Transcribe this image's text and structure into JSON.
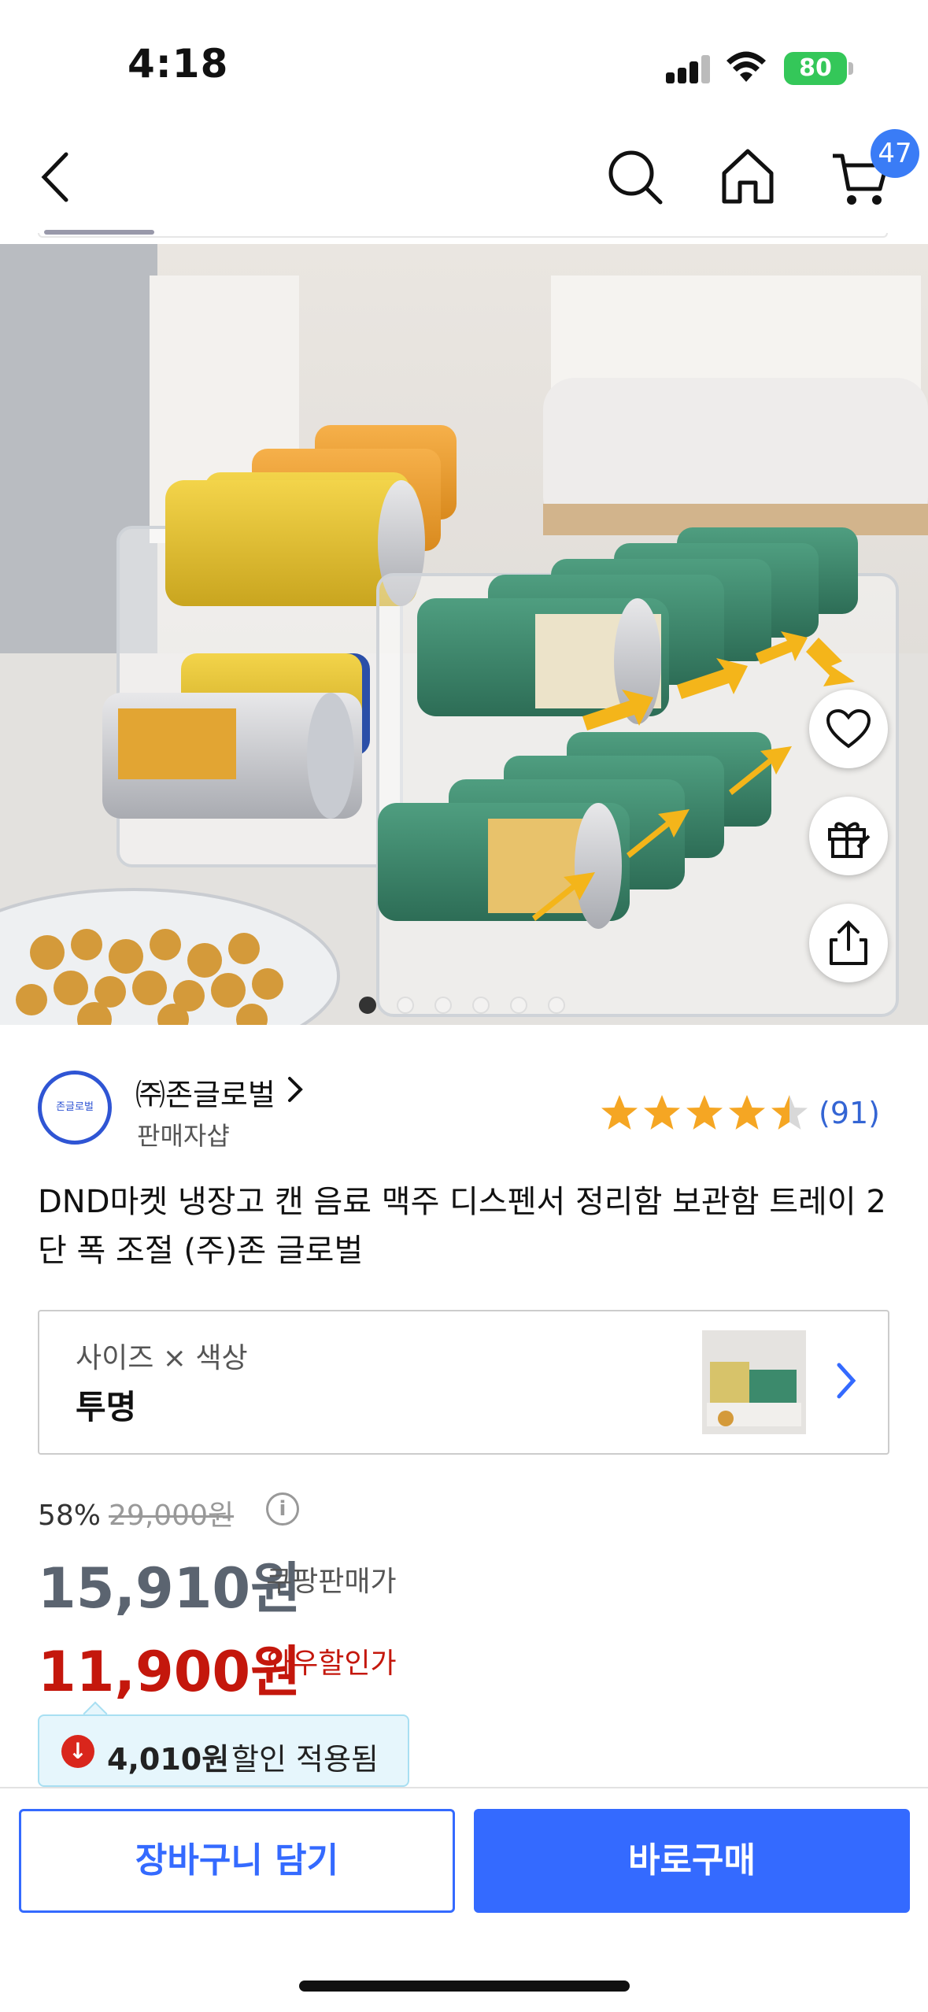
{
  "status_bar": {
    "time": "4:18",
    "battery": "80"
  },
  "header": {
    "back_icon": "chevron-left-icon",
    "search_icon": "search-icon",
    "home_icon": "home-icon",
    "cart_icon": "cart-icon",
    "cart_count": "47"
  },
  "gallery": {
    "image_count": 6,
    "active_index": 0,
    "actions": [
      "heart-icon",
      "gift-icon",
      "share-icon"
    ]
  },
  "seller": {
    "logo_text": "존글로벌",
    "name": "㈜존글로벌",
    "subtitle": "판매자샵",
    "rating": 4.5,
    "review_count": "(91)"
  },
  "product": {
    "title": "DND마켓 냉장고 캔 음료 맥주 디스펜서 정리함 보관함 트레이 2단 폭 조절 (주)존 글로벌"
  },
  "option": {
    "label": "사이즈 × 색상",
    "value": "투명"
  },
  "price": {
    "discount_rate": "58%",
    "original": "29,000원",
    "coupang_price": "15,910원",
    "coupang_label": "쿠팡판매가",
    "wow_price": "11,900원",
    "wow_label": "와우할인가",
    "coupon_amount": "4,010원",
    "coupon_text": "할인 적용됨"
  },
  "actions": {
    "add_to_cart": "장바구니 담기",
    "buy_now": "바로구매"
  },
  "colors": {
    "accent": "#346aff",
    "wow_red": "#c4170c",
    "star": "#f5a623"
  }
}
